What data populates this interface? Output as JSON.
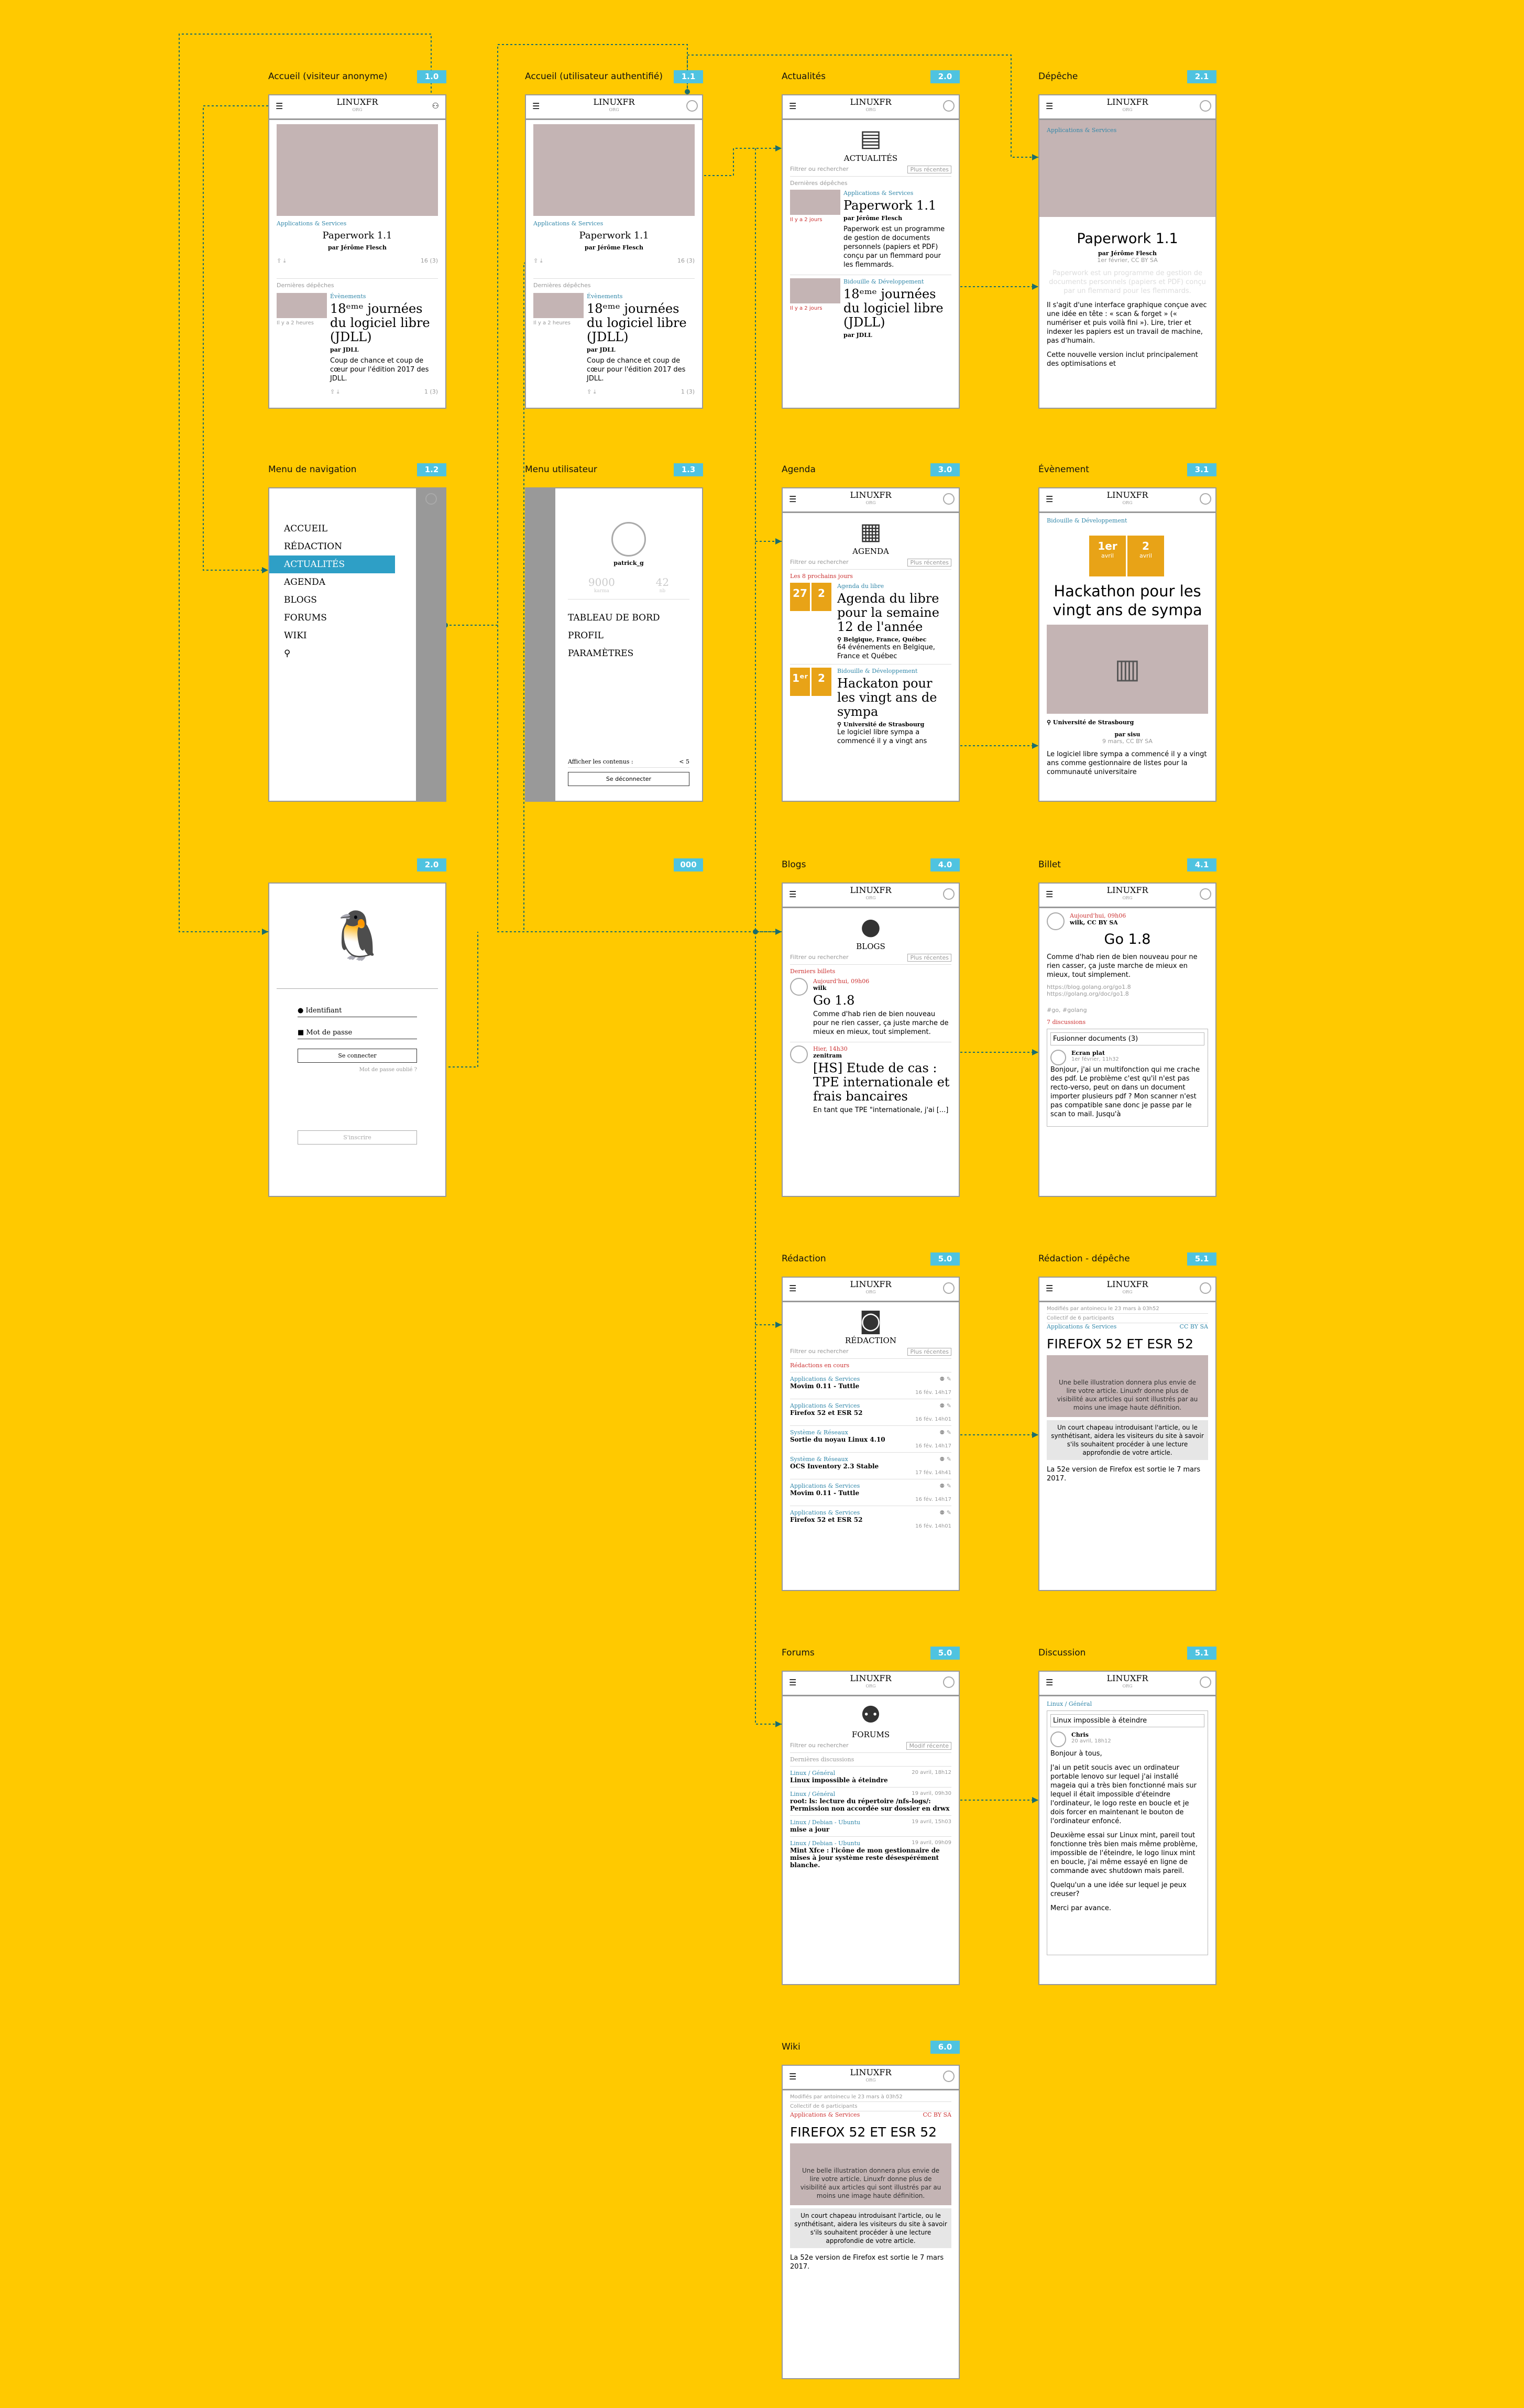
{
  "labels": {
    "anon": "Accueil (visiteur anonyme)",
    "auth": "Accueil (utilisateur authentifié)",
    "actu": "Actualités",
    "dep": "Dépêche",
    "nav": "Menu de navigation",
    "user": "Menu utilisateur",
    "agenda": "Agenda",
    "event": "Évènement",
    "login": "",
    "blogs": "Blogs",
    "billet": "Billet",
    "redac": "Rédaction",
    "redacdep": "Rédaction - dépêche",
    "forums": "Forums",
    "disc": "Discussion",
    "wiki": "Wiki"
  },
  "badges": {
    "anon": "1.0",
    "auth": "1.1",
    "actu": "2.0",
    "dep": "2.1",
    "nav": "1.2",
    "user": "1.3",
    "agenda": "3.0",
    "event": "3.1",
    "login": "2.0",
    "login2": "000",
    "blogs": "4.0",
    "billet": "4.1",
    "redac": "5.0",
    "redacdep": "5.1",
    "forums": "5.0",
    "disc": "5.1",
    "wiki": "6.0"
  },
  "header": {
    "logo": "LINUXFR",
    "sub": "ORG"
  },
  "home": {
    "cat1": "Applications & Services",
    "title1": "Paperwork 1.1",
    "by1": "par Jérôme Flesch",
    "comments1": "16 (3)",
    "section": "Dernières dépêches",
    "cat2": "Évènements",
    "ago": "Il y a 2 heures",
    "title2": "18ᵉᵐᵉ journées du logiciel libre (JDLL)",
    "by2": "par JDLL",
    "text2": "Coup de chance et coup de cœur pour l'édition 2017 des JDLL.",
    "comments2": "1 (3)"
  },
  "actu": {
    "caption": "ACTUALITÉS",
    "filter": "Filtrer ou rechercher",
    "sort": "Plus récentes",
    "section": "Dernières dépêches",
    "cat1": "Applications & Services",
    "ago1": "Il y a 2 jours",
    "title1": "Paperwork 1.1",
    "by1": "par Jérôme Flesch",
    "text1": "Paperwork est un programme de gestion de documents personnels (papiers et PDF) conçu par un flemmard pour les flemmards.",
    "cat2": "Bidouille & Développement",
    "ago2": "Il y a 2 jours",
    "title2": "18ᵉᵐᵉ journées du logiciel libre (JDLL)",
    "by2": "par JDLL"
  },
  "dep": {
    "cat": "Applications & Services",
    "title": "Paperwork 1.1",
    "by": "par Jérôme Flesch",
    "date": "1er février, CC BY SA",
    "lead": "Paperwork est un programme de gestion de documents personnels (papiers et PDF) conçu par un flemmard pour les flemmards.",
    "p1": "Il s'agit d'une interface graphique conçue avec une idée en tête : « scan & forget » (« numériser et puis voilà fini »). Lire, trier et indexer les papiers est un travail de machine, pas d'humain.",
    "p2": "Cette nouvelle version inclut principalement des optimisations et"
  },
  "nav": {
    "items": [
      "ACCUEIL",
      "RÉDACTION",
      "ACTUALITÉS",
      "AGENDA",
      "BLOGS",
      "FORUMS",
      "WIKI"
    ]
  },
  "user": {
    "name": "patrick_g",
    "score": "9000",
    "scoreLabel": "karma",
    "count": "42",
    "countLabel": "nb",
    "items": [
      "TABLEAU DE BORD",
      "PROFIL",
      "PARAMÈTRES"
    ],
    "show": "Afficher les contenus :",
    "showVal": "< 5",
    "logout": "Se déconnecter"
  },
  "agenda": {
    "caption": "AGENDA",
    "section": "Les 8 prochains jours",
    "cat1": "Agenda du libre",
    "title1": "Agenda du libre pour la semaine 12 de l'année",
    "loc1": "Belgique, France, Québec",
    "text1": "64 événements en Belgique, France et Québec",
    "cat2": "Bidouille & Développement",
    "title2": "Hackaton pour les vingt ans de sympa",
    "loc2": "Université de Strasbourg",
    "text2": "Le logiciel libre sympa a commencé il y a vingt ans"
  },
  "event": {
    "cat": "Bidouille & Développement",
    "d1": "1er",
    "d2": "2",
    "m": "avril",
    "title": "Hackathon pour les vingt ans de sympa",
    "loc": "Université de Strasbourg",
    "by": "par sisu",
    "date": "9 mars, CC BY SA",
    "text": "Le logiciel libre sympa a commencé il y a vingt ans comme gestionnaire de listes pour la communauté universitaire"
  },
  "login": {
    "id": "Identifiant",
    "pw": "Mot de passe",
    "btn": "Se connecter",
    "forgot": "Mot de passe oublié ?",
    "register": "S'inscrire"
  },
  "blogs": {
    "caption": "BLOGS",
    "section": "Derniers billets",
    "date1": "Aujourd'hui, 09h06",
    "by1": "wilk",
    "title1": "Go 1.8",
    "text1": "Comme d'hab rien de bien nouveau pour ne rien casser, ça juste marche de mieux en mieux, tout simplement.",
    "date2": "Hier, 14h30",
    "by2": "zenitram",
    "title2": "[HS] Etude de cas : TPE internationale et frais bancaires",
    "text2": "En tant que TPE \"internationale, j'ai [...]"
  },
  "billet": {
    "date": "Aujourd'hui, 09h06",
    "by": "wilk, CC BY SA",
    "title": "Go 1.8",
    "text": "Comme d'hab rien de bien nouveau pour ne rien casser, ça juste marche de mieux en mieux, tout simplement.",
    "l1": "https://blog.golang.org/go1.8",
    "l2": "https://golang.org/doc/go1.8",
    "tags": "#go, #golang",
    "disc": "7 discussions",
    "merge": "Fusionner documents (3)",
    "cauthor": "Ecran plat",
    "cdate": "1er février, 11h32",
    "ctext": "Bonjour, j'ai un multifonction qui me crache des pdf. Le problème c'est qu'il n'est pas recto-verso, peut on dans un document importer plusieurs pdf ? Mon scanner n'est pas compatible sane donc je passe par le scan to mail. Jusqu'à"
  },
  "redac": {
    "caption": "RÉDACTION",
    "section": "Rédactions en cours",
    "rows": [
      {
        "cat": "Applications & Services",
        "title": "Movim 0.11 - Tuttle",
        "date": "16 fév. 14h17"
      },
      {
        "cat": "Applications & Services",
        "title": "Firefox 52 et ESR 52",
        "date": "16 fév. 14h01"
      },
      {
        "cat": "Système & Réseaux",
        "title": "Sortie du noyau Linux 4.10",
        "date": "16 fév. 14h17"
      },
      {
        "cat": "Système & Réseaux",
        "title": "OCS Inventory 2.3 Stable",
        "date": "17 fév. 14h41"
      },
      {
        "cat": "Applications & Services",
        "title": "Movim 0.11 - Tuttle",
        "date": "16 fév. 14h17"
      },
      {
        "cat": "Applications & Services",
        "title": "Firefox 52 et ESR 52",
        "date": "16 fév. 14h01"
      }
    ]
  },
  "wiki": {
    "mod": "Modifiés par antoinecu le 23 mars à 03h52",
    "collab": "Collectif de 6 participants",
    "cat": "Applications & Services",
    "lic": "CC BY SA",
    "title": "FIREFOX 52 ET ESR 52",
    "img": "Une belle illustration donnera plus envie de lire votre article. Linuxfr donne plus de visibilité aux articles qui sont illustrés par au moins une image haute définition.",
    "chapo": "Un court chapeau introduisant l'article, ou le synthétisant, aidera les visiteurs du site à savoir s'ils souhaitent procéder à une lecture approfondie de votre article.",
    "text": "La 52e version de Firefox est sortie le 7 mars 2017."
  },
  "forums": {
    "caption": "FORUMS",
    "sort": "Modif récente",
    "section": "Dernières discussions",
    "rows": [
      {
        "cat": "Linux / Général",
        "title": "Linux impossible à éteindre",
        "date": "20 avril, 18h12"
      },
      {
        "cat": "Linux / Général",
        "title": "root: ls: lecture du répertoire /nfs-logs/: Permission non accordée sur dossier en drwx",
        "date": "19 avril, 09h30"
      },
      {
        "cat": "Linux / Debian - Ubuntu",
        "title": "mise a jour",
        "date": "19 avril, 15h03"
      },
      {
        "cat": "Linux / Debian - Ubuntu",
        "title": "Mint Xfce : l'icône de mon gestionnaire de mises à jour système reste désespérément blanche.",
        "date": "19 avril, 09h09"
      }
    ]
  },
  "disc": {
    "cat": "Linux / Général",
    "title": "Linux impossible à éteindre",
    "author": "Chris",
    "date": "20 avril, 18h12",
    "p1": "Bonjour à tous,",
    "p2": "J'ai un petit soucis avec un ordinateur portable lenovo sur lequel j'ai installé mageia qui a très bien fonctionné mais sur lequel il était impossible d'éteindre l'ordinateur, le logo reste en boucle et je dois forcer en maintenant le bouton de l'ordinateur enfoncé.",
    "p3": "Deuxième essai sur Linux mint, pareil tout fonctionne très bien mais même problème, impossible de l'éteindre, le logo linux mint en boucle, j'ai même essayé en ligne de commande avec shutdown mais pareil.",
    "p4": "Quelqu'un a une idée sur lequel je peux creuser?",
    "p5": "Merci par avance."
  }
}
